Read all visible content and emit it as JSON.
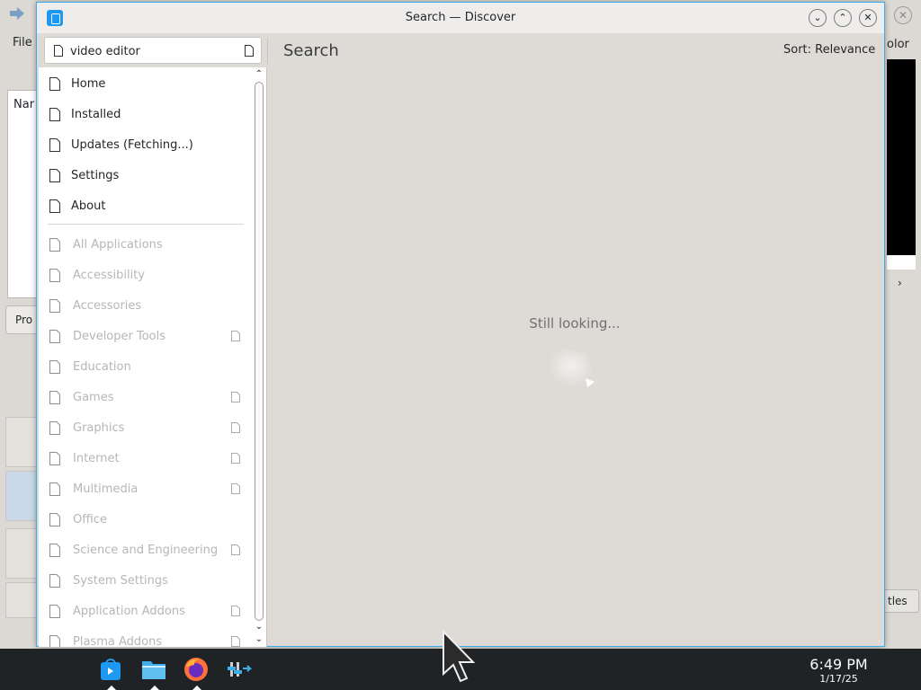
{
  "background_window": {
    "menu_file": "File",
    "menu_partial_right": "olor",
    "name_column_partial": "Nar",
    "tab_partial": "Pro",
    "button_partial": "tles"
  },
  "window": {
    "title": "Search — Discover",
    "buttons": {
      "minimize": "⌄",
      "maximize": "⌃",
      "close": "✕"
    }
  },
  "search": {
    "value": "video editor"
  },
  "header": {
    "page_title": "Search",
    "sort_label": "Sort: Relevance"
  },
  "sidebar": {
    "primary": [
      {
        "label": "Home"
      },
      {
        "label": "Installed"
      },
      {
        "label": "Updates (Fetching...)"
      },
      {
        "label": "Settings"
      },
      {
        "label": "About"
      }
    ],
    "categories": [
      {
        "label": "All Applications",
        "has_sub": false
      },
      {
        "label": "Accessibility",
        "has_sub": false
      },
      {
        "label": "Accessories",
        "has_sub": false
      },
      {
        "label": "Developer Tools",
        "has_sub": true
      },
      {
        "label": "Education",
        "has_sub": false
      },
      {
        "label": "Games",
        "has_sub": true
      },
      {
        "label": "Graphics",
        "has_sub": true
      },
      {
        "label": "Internet",
        "has_sub": true
      },
      {
        "label": "Multimedia",
        "has_sub": true
      },
      {
        "label": "Office",
        "has_sub": false
      },
      {
        "label": "Science and Engineering",
        "has_sub": true
      },
      {
        "label": "System Settings",
        "has_sub": false
      },
      {
        "label": "Application Addons",
        "has_sub": true
      },
      {
        "label": "Plasma Addons",
        "has_sub": true
      }
    ]
  },
  "content": {
    "status_text": "Still looking..."
  },
  "taskbar": {
    "apps": [
      "discover-icon",
      "file-manager-icon",
      "firefox-icon",
      "system-settings-icon"
    ],
    "time": "6:49 PM",
    "date": "1/17/25"
  },
  "colors": {
    "accent": "#3daee9",
    "taskbar": "#202326",
    "window_bg": "#dedbd6"
  }
}
